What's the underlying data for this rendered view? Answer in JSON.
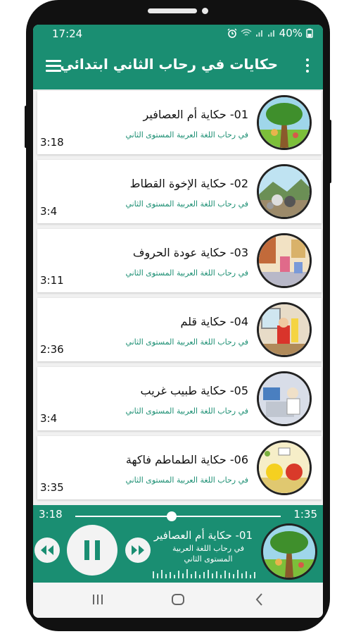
{
  "status_bar": {
    "time": "17:24",
    "battery": "40%"
  },
  "toolbar": {
    "title": "حكايات في رحاب الثاني ابتدائي"
  },
  "stories": [
    {
      "title": "01- حكاية أم العصافير",
      "subtitle": "في رحاب اللغة العربية المستوى الثاني",
      "duration": "3:18"
    },
    {
      "title": "02- حكاية الإخوة القطاط",
      "subtitle": "في رحاب اللغة العربية المستوى الثاني",
      "duration": "3:4"
    },
    {
      "title": "03- حكاية عودة الحروف",
      "subtitle": "في رحاب اللغة العربية المستوى الثاني",
      "duration": "3:11"
    },
    {
      "title": "04- حكاية قلم",
      "subtitle": "في رحاب اللغة العربية المستوى الثاني",
      "duration": "2:36"
    },
    {
      "title": "05- حكاية طبيب غريب",
      "subtitle": "في رحاب اللغة العربية المستوى الثاني",
      "duration": "3:4"
    },
    {
      "title": "06- حكاية الطماطم فاكهة",
      "subtitle": "في رحاب اللغة العربية المستوى الثاني",
      "duration": "3:35"
    }
  ],
  "player": {
    "elapsed": "3:18",
    "remaining": "1:35",
    "progress": 0.47,
    "now_playing_title": "01- حكاية أم العصافير",
    "now_playing_subtitle": "في رحاب اللغة العربية المستوى الثاني"
  },
  "colors": {
    "primary": "#1a8e72",
    "background": "#f1f1f1",
    "card": "#ffffff"
  },
  "icons": {
    "menu": "menu-icon",
    "more": "more-vert-icon",
    "rewind": "rewind-icon",
    "pause": "pause-icon",
    "fast_forward": "fast-forward-icon",
    "recents": "recents-icon",
    "home": "home-icon",
    "back": "back-icon"
  }
}
